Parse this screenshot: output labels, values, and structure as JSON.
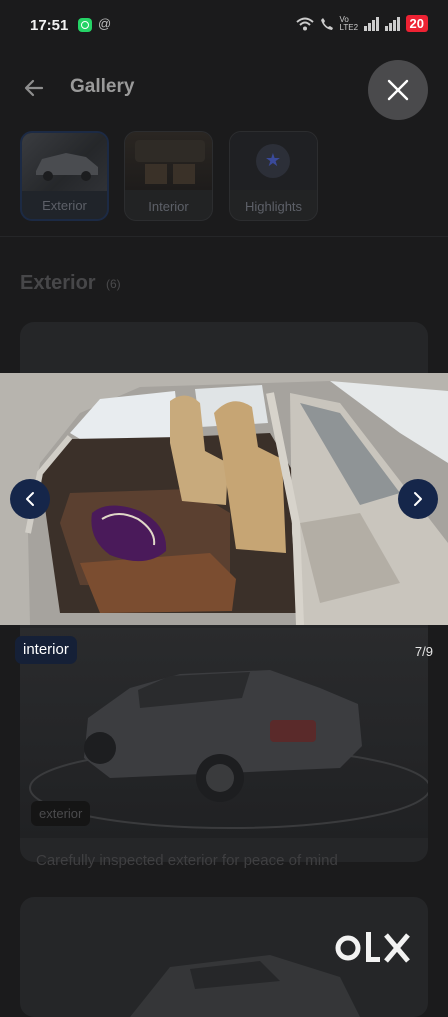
{
  "status_bar": {
    "time": "17:51",
    "battery": "20",
    "net_label": "Vo LTE2"
  },
  "header": {
    "title": "Gallery"
  },
  "tabs": [
    {
      "label": "Exterior",
      "active": true
    },
    {
      "label": "Interior",
      "active": false
    },
    {
      "label": "Highlights",
      "active": false
    }
  ],
  "section": {
    "title": "Exterior",
    "count": "(6)"
  },
  "viewer": {
    "tag": "interior",
    "counter": "7/9"
  },
  "card": {
    "badge": "exterior",
    "caption": "Carefully inspected exterior for peace of mind"
  },
  "brand": {
    "logo_text": "OLX"
  },
  "colors": {
    "nav_button": "#15264a",
    "battery": "#e23344",
    "background": "#1b1b1c"
  },
  "icons": [
    "back-arrow-icon",
    "close-icon",
    "chevron-left-icon",
    "chevron-right-icon",
    "star-icon",
    "whatsapp-icon",
    "wifi-icon",
    "call-icon",
    "signal-icon",
    "battery-icon"
  ]
}
